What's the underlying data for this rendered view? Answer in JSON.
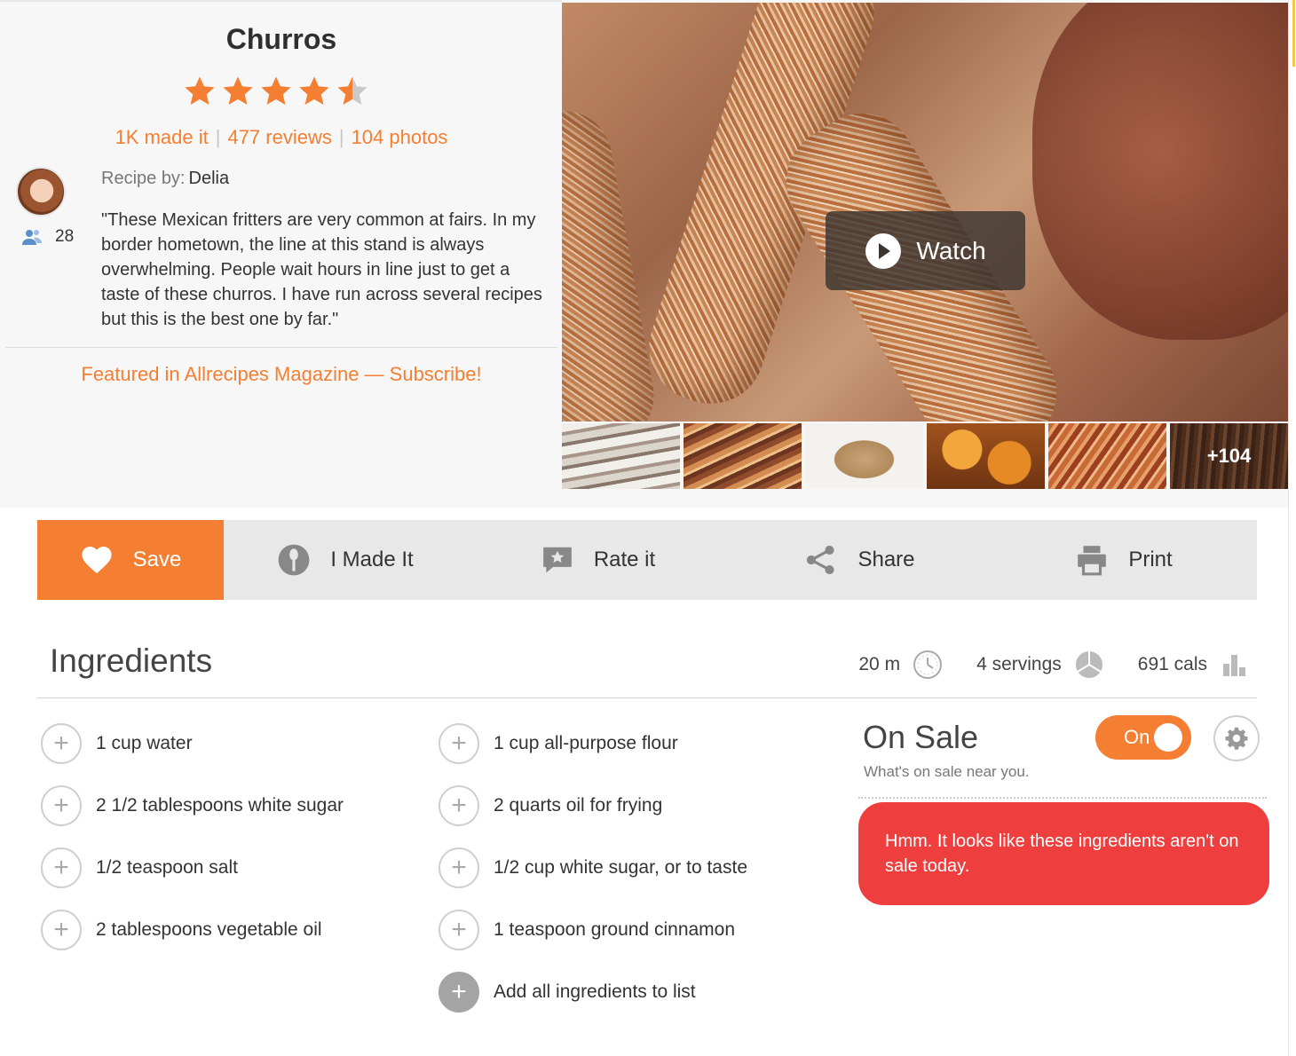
{
  "recipe": {
    "title": "Churros",
    "rating": 4.5,
    "rating_max": 5,
    "stats": {
      "made_it": "1K made it",
      "reviews": "477 reviews",
      "photos": "104 photos"
    },
    "byline_label": "Recipe by:",
    "author": "Delia",
    "followers": "28",
    "description": "\"These Mexican fritters are very common at fairs. In my border hometown, the line at this stand is always overwhelming. People wait hours in line just to get a taste of these churros. I have run across several recipes but this is the best one by far.\"",
    "featured_link": "Featured in Allrecipes Magazine — Subscribe!",
    "watch_label": "Watch",
    "more_photos": "+104"
  },
  "actions": {
    "save": "Save",
    "made_it": "I Made It",
    "rate": "Rate it",
    "share": "Share",
    "print": "Print"
  },
  "ingredients_section": {
    "title": "Ingredients",
    "time": "20 m",
    "servings": "4 servings",
    "calories": "691 cals",
    "left_column": [
      "1 cup water",
      "2 1/2 tablespoons white sugar",
      "1/2 teaspoon salt",
      "2 tablespoons vegetable oil"
    ],
    "right_column": [
      "1 cup all-purpose flour",
      "2 quarts oil for frying",
      "1/2 cup white sugar, or to taste",
      "1 teaspoon ground cinnamon"
    ],
    "add_all": "Add all ingredients to list"
  },
  "on_sale": {
    "title": "On Sale",
    "subtitle": "What's on sale near you.",
    "toggle_label": "On",
    "toggle_state": true,
    "message": "Hmm. It looks like these ingredients aren't on sale today."
  },
  "colors": {
    "accent": "#f47f33",
    "alert": "#ef3e3e",
    "bar": "#e8e8e8"
  },
  "icons": [
    "star-icon",
    "followers-icon",
    "play-icon",
    "heart-icon",
    "i-made-it-icon",
    "rate-icon",
    "share-icon",
    "print-icon",
    "clock-icon",
    "servings-icon",
    "nutrition-icon",
    "plus-icon",
    "gear-icon"
  ]
}
